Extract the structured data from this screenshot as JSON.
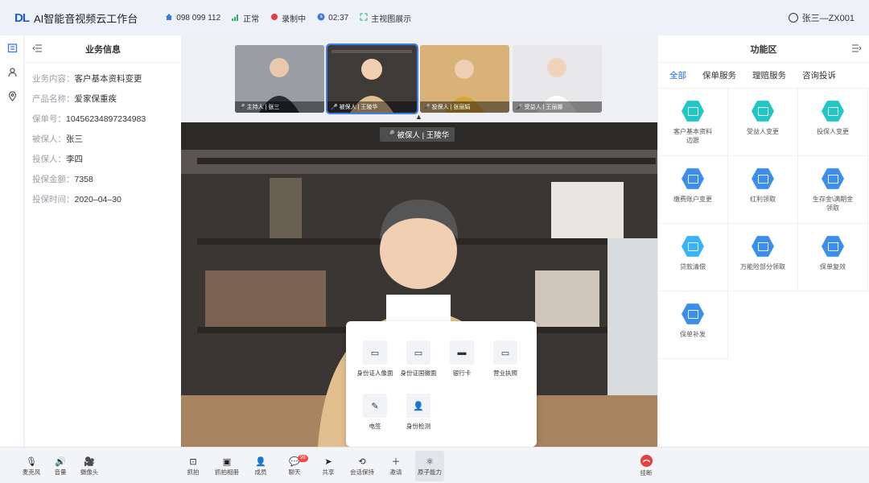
{
  "header": {
    "logo": "DL",
    "title": "AI智能音视频云工作台",
    "phone": "098 099 112",
    "signal": "正常",
    "recording": "录制中",
    "timer": "02:37",
    "view_mode": "主视图展示",
    "user": "张三—ZX001"
  },
  "business_info": {
    "title": "业务信息",
    "rows": [
      {
        "k": "业务内容：",
        "v": "客户基本资料变更"
      },
      {
        "k": "产品名称：",
        "v": "爱家保重疾"
      },
      {
        "k": "保单号：",
        "v": "10456234897234983"
      },
      {
        "k": "被保人：",
        "v": "张三"
      },
      {
        "k": "投保人：",
        "v": "李四"
      },
      {
        "k": "投保金额：",
        "v": "7358"
      },
      {
        "k": "投保时间：",
        "v": "2020–04–30"
      }
    ]
  },
  "participants": [
    {
      "label": "主持人 | 张三"
    },
    {
      "label": "被保人 | 王陵华"
    },
    {
      "label": "投保人 | 张丽娟"
    },
    {
      "label": "受益人 | 王丽娜"
    }
  ],
  "speaker_label": "被保人 | 王陵华",
  "atomic_popup": {
    "items": [
      {
        "label": "身份证人像面"
      },
      {
        "label": "身份证国徽面"
      },
      {
        "label": "银行卡"
      },
      {
        "label": "营业执照"
      },
      {
        "label": "电签"
      },
      {
        "label": "身份检测"
      }
    ]
  },
  "function_area": {
    "title": "功能区",
    "tabs": [
      "全部",
      "保单服务",
      "理赔服务",
      "咨询投诉"
    ],
    "items": [
      {
        "label": "客户基本资料\n边跟",
        "tone": "teal"
      },
      {
        "label": "受益人变更",
        "tone": "teal"
      },
      {
        "label": "投保人变更",
        "tone": "teal"
      },
      {
        "label": "缴费账户变更",
        "tone": "blue"
      },
      {
        "label": "红利领取",
        "tone": "blue"
      },
      {
        "label": "生存金\\满期金\n领取",
        "tone": "blue"
      },
      {
        "label": "贷款清偿",
        "tone": "sky"
      },
      {
        "label": "万能险部分领取",
        "tone": "blue"
      },
      {
        "label": "保单复效",
        "tone": "blue"
      },
      {
        "label": "保单补发",
        "tone": "blue"
      }
    ]
  },
  "bottom_bar": {
    "left": [
      "麦克风",
      "音量",
      "摄像头"
    ],
    "center": [
      "抓拍",
      "抓拍相册",
      "成员",
      "聊天",
      "共享",
      "会话保持",
      "邀请",
      "原子能力"
    ],
    "chat_badge": "99",
    "hangup": "挂断"
  },
  "colors": {
    "accent": "#1f6fe6",
    "cyan": "#35b3ff",
    "teal": "#1fc7c6",
    "danger": "#ea3e3e"
  }
}
